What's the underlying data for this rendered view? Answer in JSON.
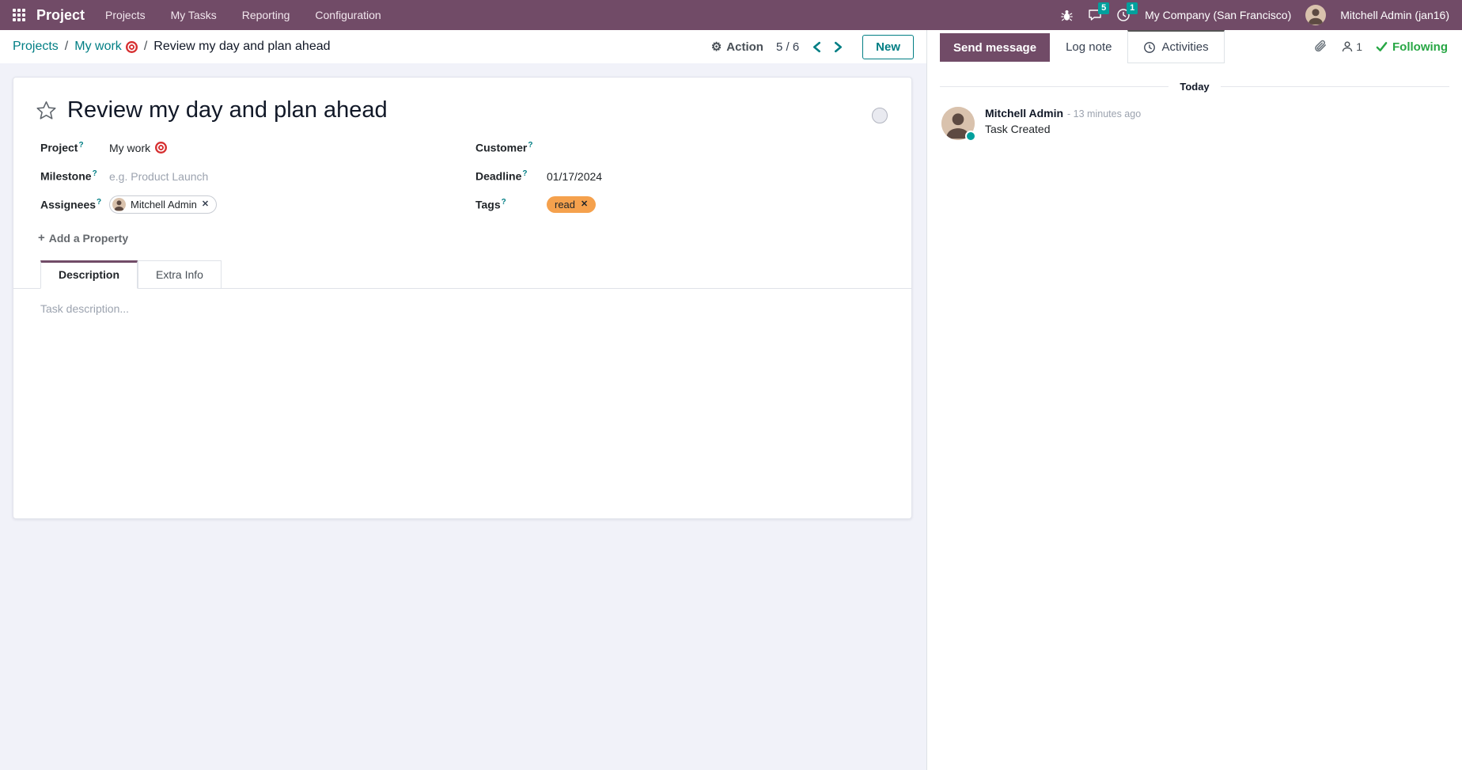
{
  "navbar": {
    "app_name": "Project",
    "menu_items": [
      "Projects",
      "My Tasks",
      "Reporting",
      "Configuration"
    ],
    "message_badge": "5",
    "activity_badge": "1",
    "company": "My Company (San Francisco)",
    "user": "Mitchell Admin (jan16)"
  },
  "control_panel": {
    "breadcrumb_projects": "Projects",
    "breadcrumb_project": "My work",
    "breadcrumb_task": "Review my day and plan ahead",
    "separator": "/",
    "action_label": "Action",
    "pager": "5 / 6",
    "new_label": "New"
  },
  "form": {
    "title": "Review my day and plan ahead",
    "fields": {
      "project": {
        "label": "Project",
        "value": "My work"
      },
      "milestone": {
        "label": "Milestone",
        "placeholder": "e.g. Product Launch"
      },
      "assignees": {
        "label": "Assignees",
        "assignee_name": "Mitchell Admin"
      },
      "customer": {
        "label": "Customer",
        "value": ""
      },
      "deadline": {
        "label": "Deadline",
        "value": "01/17/2024"
      },
      "tags": {
        "label": "Tags",
        "tag_value": "read"
      }
    },
    "add_property_label": "Add a Property",
    "tabs": {
      "description": "Description",
      "extra_info": "Extra Info"
    },
    "description_placeholder": "Task description..."
  },
  "chatter": {
    "send_message": "Send message",
    "log_note": "Log note",
    "activities": "Activities",
    "followers_count": "1",
    "following": "Following",
    "date_divider": "Today",
    "message": {
      "author": "Mitchell Admin",
      "time": "- 13 minutes ago",
      "body": "Task Created"
    }
  },
  "icons": {
    "help": "?",
    "plus": "+",
    "close": "✕",
    "gear": "⚙"
  },
  "colors": {
    "primary": "#714B67",
    "accent": "#017E84",
    "badge": "#00A09D",
    "tag_orange": "#F5A14D",
    "success_green": "#28a745",
    "page_background": "#F1F2F9"
  }
}
